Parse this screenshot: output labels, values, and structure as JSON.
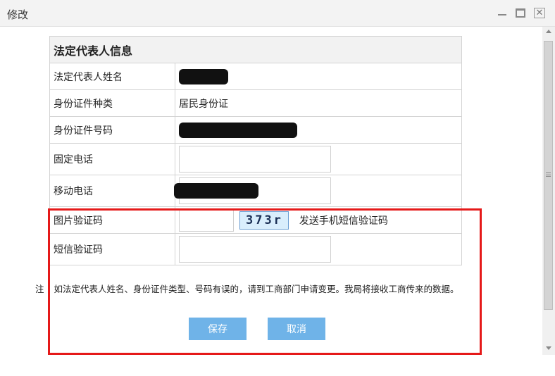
{
  "dialog": {
    "title": "修改"
  },
  "form": {
    "section_title": "法定代表人信息",
    "rows": {
      "name": {
        "label": "法定代表人姓名",
        "value": ""
      },
      "id_type": {
        "label": "身份证件种类",
        "value": "居民身份证"
      },
      "id_number": {
        "label": "身份证件号码",
        "value": ""
      },
      "landline": {
        "label": "固定电话",
        "value": ""
      },
      "mobile": {
        "label": "移动电话",
        "value": ""
      },
      "captcha": {
        "label": "图片验证码",
        "value": "",
        "captcha_text": "373r",
        "send_sms_label": "发送手机短信验证码"
      },
      "sms_code": {
        "label": "短信验证码",
        "value": ""
      }
    }
  },
  "note": {
    "prefix": "注",
    "text": "如法定代表人姓名、身份证件类型、号码有误的，请到工商部门申请变更。我局将接收工商传来的数据。"
  },
  "buttons": {
    "save": "保存",
    "cancel": "取消"
  },
  "colors": {
    "button_bg": "#6fb3e8",
    "highlight_border": "#e51919"
  }
}
